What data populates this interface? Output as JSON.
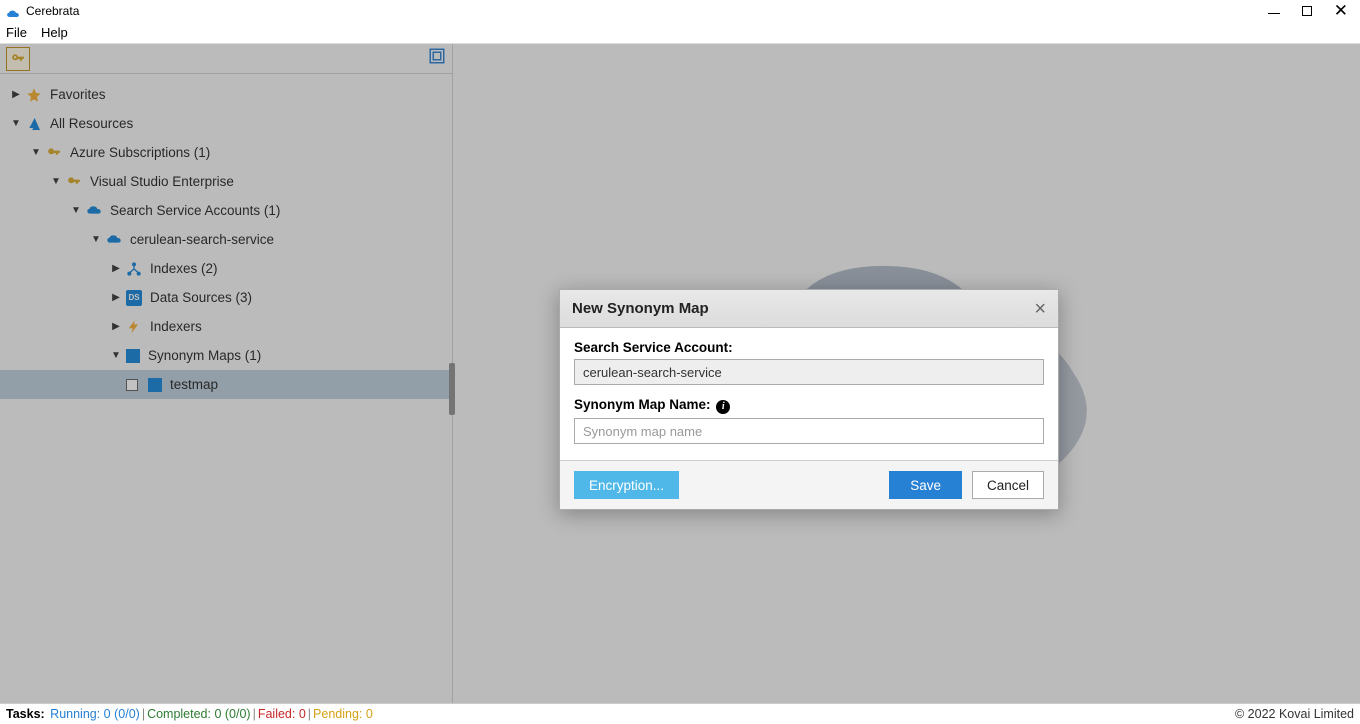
{
  "app": {
    "title": "Cerebrata"
  },
  "menu": {
    "file": "File",
    "help": "Help"
  },
  "tree": {
    "favorites": "Favorites",
    "all_resources": "All Resources",
    "azure_subs": "Azure Subscriptions (1)",
    "vs_enterprise": "Visual Studio Enterprise",
    "search_accounts": "Search Service Accounts (1)",
    "cerulean": "cerulean-search-service",
    "indexes": "Indexes (2)",
    "datasources": "Data Sources (3)",
    "indexers": "Indexers",
    "synonym_maps": "Synonym Maps (1)",
    "testmap": "testmap"
  },
  "dialog": {
    "title": "New Synonym Map",
    "account_label": "Search Service Account:",
    "account_value": "cerulean-search-service",
    "name_label": "Synonym Map Name:",
    "name_placeholder": "Synonym map name",
    "encryption": "Encryption...",
    "save": "Save",
    "cancel": "Cancel"
  },
  "status": {
    "tasks": "Tasks",
    "running": "Running: 0 (0/0)",
    "completed": "Completed: 0 (0/0)",
    "failed": "Failed: 0",
    "pending": "Pending: 0",
    "copyright": "© 2022 Kovai Limited"
  }
}
